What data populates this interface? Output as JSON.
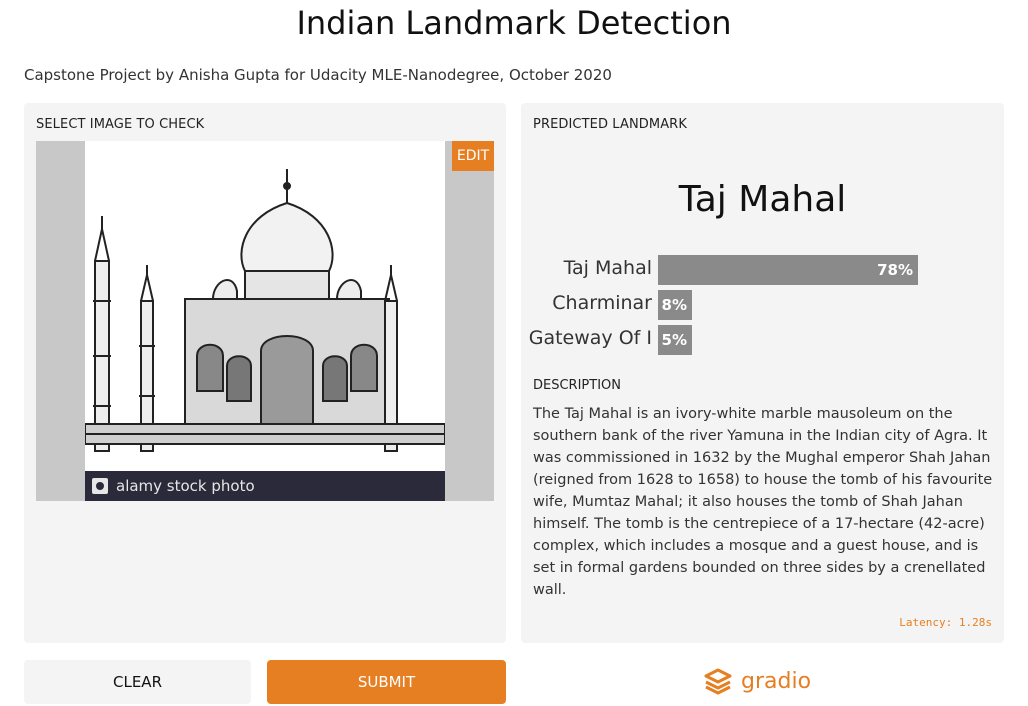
{
  "header": {
    "title": "Indian Landmark Detection",
    "subtitle": "Capstone Project by Anisha Gupta for Udacity MLE-Nanodegree, October 2020"
  },
  "input_panel": {
    "label": "SELECT IMAGE TO CHECK",
    "edit_label": "EDIT",
    "watermark_text": "alamy stock photo"
  },
  "output_panel": {
    "label": "PREDICTED LANDMARK",
    "prediction": "Taj Mahal",
    "confidences": [
      {
        "label": "Taj Mahal",
        "value_text": "78%",
        "value": 0.78
      },
      {
        "label": "Charminar",
        "value_text": "8%",
        "value": 0.08
      },
      {
        "label": "Gateway Of I",
        "value_text": "5%",
        "value": 0.05
      }
    ],
    "description_label": "DESCRIPTION",
    "description": "The Taj Mahal is an ivory-white marble mausoleum on the southern bank of the river Yamuna in the Indian city of Agra. It was commissioned in 1632 by the Mughal emperor Shah Jahan (reigned from 1628 to 1658) to house the tomb of his favourite wife, Mumtaz Mahal; it also houses the tomb of Shah Jahan himself. The tomb is the centrepiece of a 17-hectare (42-acre) complex, which includes a mosque and a guest house, and is set in formal gardens bounded on three sides by a crenellated wall.",
    "latency": "Latency: 1.28s"
  },
  "actions": {
    "clear_label": "CLEAR",
    "submit_label": "SUBMIT"
  },
  "brand": {
    "name": "gradio",
    "icon": "gradio-logo-icon"
  },
  "colors": {
    "accent": "#e67e22",
    "bar": "#8a8a8a",
    "panel": "#f4f4f4"
  }
}
